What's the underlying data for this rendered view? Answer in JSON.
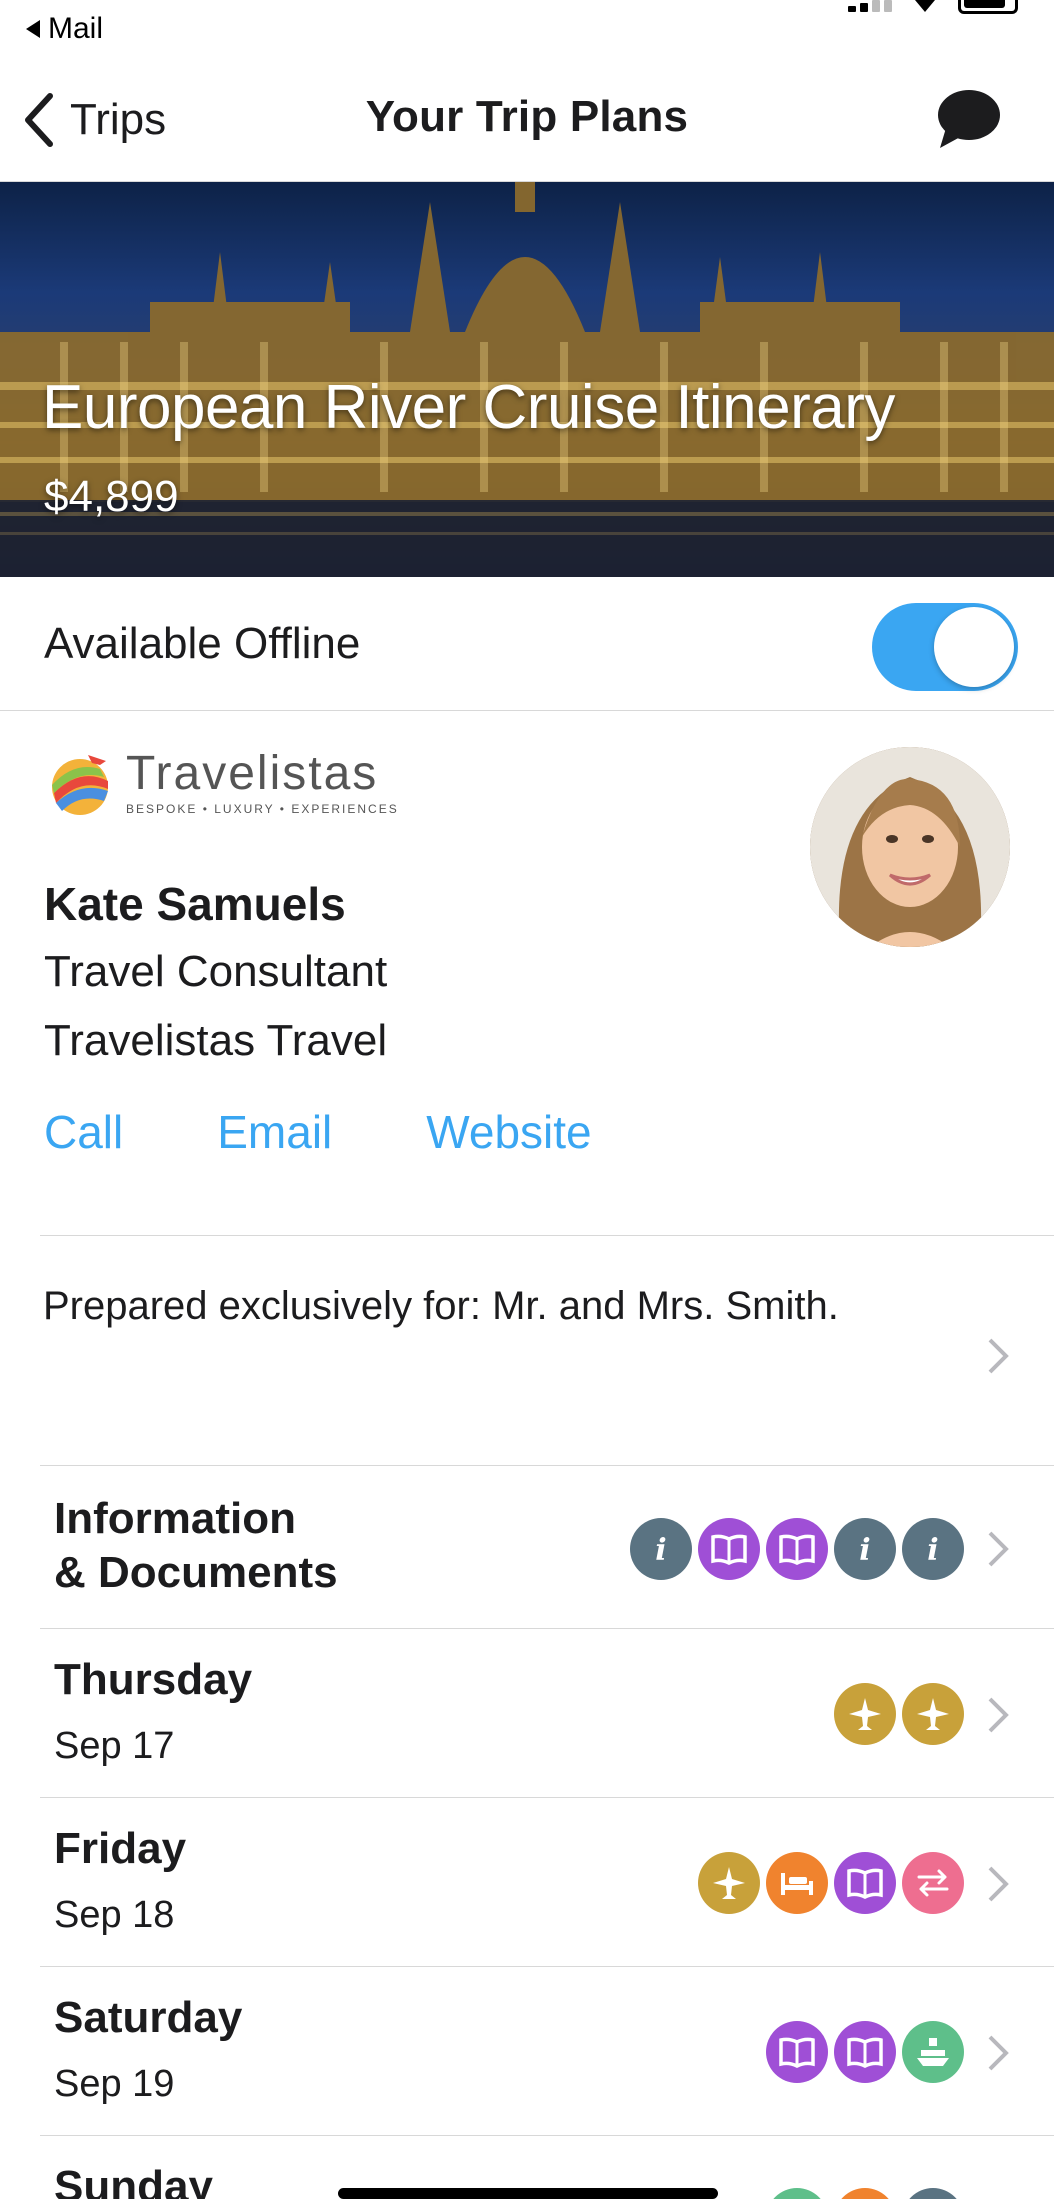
{
  "status_bar": {
    "back_app": "Mail"
  },
  "nav": {
    "back_label": "Trips",
    "title": "Your Trip Plans"
  },
  "hero": {
    "title": "European River Cruise Itinerary",
    "price": "$4,899"
  },
  "offline": {
    "label": "Available Offline",
    "enabled": true,
    "accent": "#3aa6f2"
  },
  "consultant": {
    "logo_name": "Travelistas",
    "logo_tagline": "BESPOKE • LUXURY • EXPERIENCES",
    "name": "Kate Samuels",
    "role": "Travel Consultant",
    "company": "Travelistas Travel",
    "links": {
      "call": "Call",
      "email": "Email",
      "website": "Website"
    }
  },
  "prepared": {
    "text": "Prepared exclusively for: Mr. and Mrs. Smith."
  },
  "sections": [
    {
      "title_line1": "Information",
      "title_line2": "& Documents",
      "icons": [
        "info-icon",
        "book-icon",
        "book-icon",
        "info-icon",
        "info-icon"
      ]
    },
    {
      "title": "Thursday",
      "date": "Sep 17",
      "icons": [
        "flight-icon",
        "flight-icon"
      ]
    },
    {
      "title": "Friday",
      "date": "Sep 18",
      "icons": [
        "flight-icon",
        "hotel-icon",
        "book-icon",
        "transfer-icon"
      ]
    },
    {
      "title": "Saturday",
      "date": "Sep 19",
      "icons": [
        "book-icon",
        "book-icon",
        "ship-icon"
      ]
    },
    {
      "title": "Sunday"
    }
  ],
  "colors": {
    "info": "#5a7382",
    "book": "#9f4fd6",
    "flight": "#c8a13a",
    "hotel": "#f0832e",
    "transfer": "#ee6e90",
    "ship": "#5ebf8a",
    "link": "#3aa6f2"
  }
}
